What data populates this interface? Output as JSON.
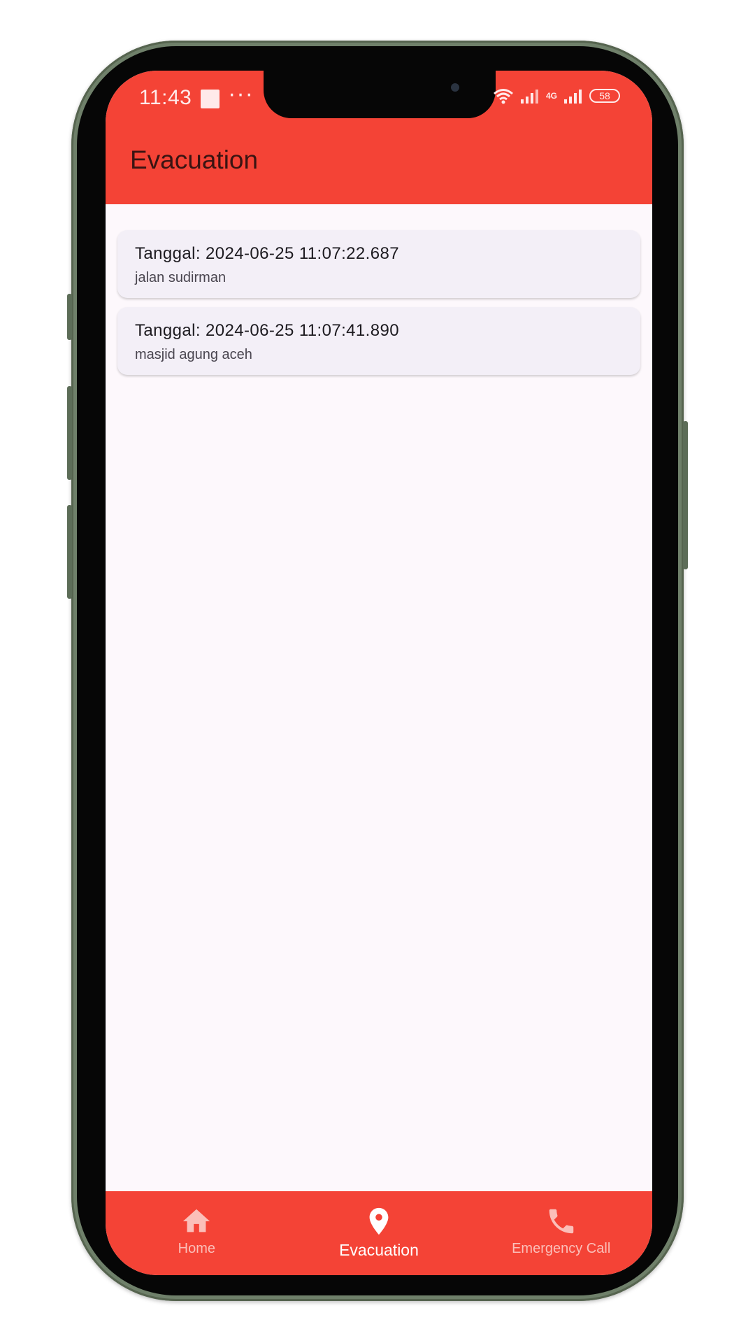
{
  "status_bar": {
    "time": "11:43",
    "more": "···",
    "network_tag": "4G",
    "battery": "58"
  },
  "header": {
    "title": "Evacuation"
  },
  "colors": {
    "app_bar": "#f44336",
    "card_background": "#f3eff7",
    "screen_background": "#fdf8fc",
    "nav_inactive": "#fbbfb9",
    "nav_active": "#ffffff"
  },
  "evacuations": [
    {
      "title": "Tanggal: 2024-06-25 11:07:22.687",
      "location": "jalan sudirman"
    },
    {
      "title": "Tanggal: 2024-06-25 11:07:41.890",
      "location": "masjid agung aceh"
    }
  ],
  "bottom_nav": {
    "items": [
      {
        "label": "Home",
        "icon": "home-icon",
        "active": false
      },
      {
        "label": "Evacuation",
        "icon": "location-pin-icon",
        "active": true
      },
      {
        "label": "Emergency Call",
        "icon": "phone-icon",
        "active": false
      }
    ]
  }
}
